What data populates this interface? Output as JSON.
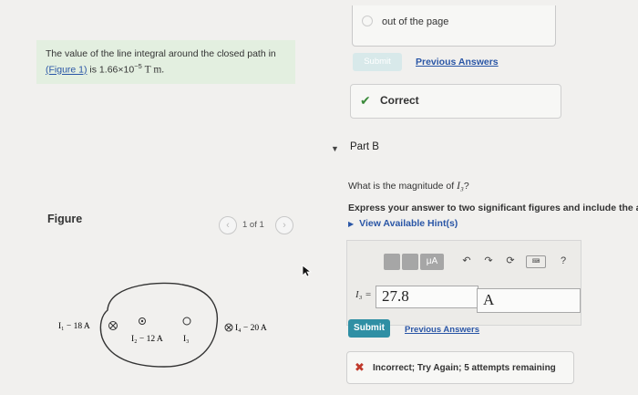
{
  "problem": {
    "text_before_link": "The value of the line integral around the closed path in",
    "link": "(Figure 1)",
    "text_after_link": " is 1.66×10",
    "exponent": "−5",
    "unit": "T m."
  },
  "figure": {
    "label": "Figure",
    "pager_count": "1 of 1",
    "prev_icon": "chevron-left-icon",
    "next_icon": "chevron-right-icon",
    "wires": {
      "i1": "I₁ − 18 A",
      "i2": "I₂ − 12 A",
      "i3": "I₃",
      "i4": "I₄ − 20 A"
    }
  },
  "part_a": {
    "out_of_page": "out of the page",
    "submit_label": "Submit",
    "previous_answers": "Previous Answers",
    "correct_label": "Correct"
  },
  "part_b": {
    "label": "Part B",
    "question_before": "What is the magnitude of ",
    "question_var": "I₃",
    "question_after": "?",
    "instruction": "Express your answer to two significant figures and include the appropriate units.",
    "hints": "View Available Hint(s)",
    "answer_label": "I₃ =",
    "answer_value": "27.8",
    "answer_unit": "A",
    "toolbar": {
      "mu": "μA",
      "undo_icon": "undo-icon",
      "redo_icon": "redo-icon",
      "reset_icon": "reset-icon",
      "keyboard_icon": "keyboard-icon",
      "help": "?"
    },
    "submit_label": "Submit",
    "previous_answers": "Previous Answers",
    "feedback": "Incorrect; Try Again; 5 attempts remaining"
  },
  "colors": {
    "link": "#2a56a6",
    "correct": "#3a8a3a",
    "incorrect": "#c0392b",
    "submit": "#2f8fa4",
    "problem_bg": "#e3efe0"
  }
}
